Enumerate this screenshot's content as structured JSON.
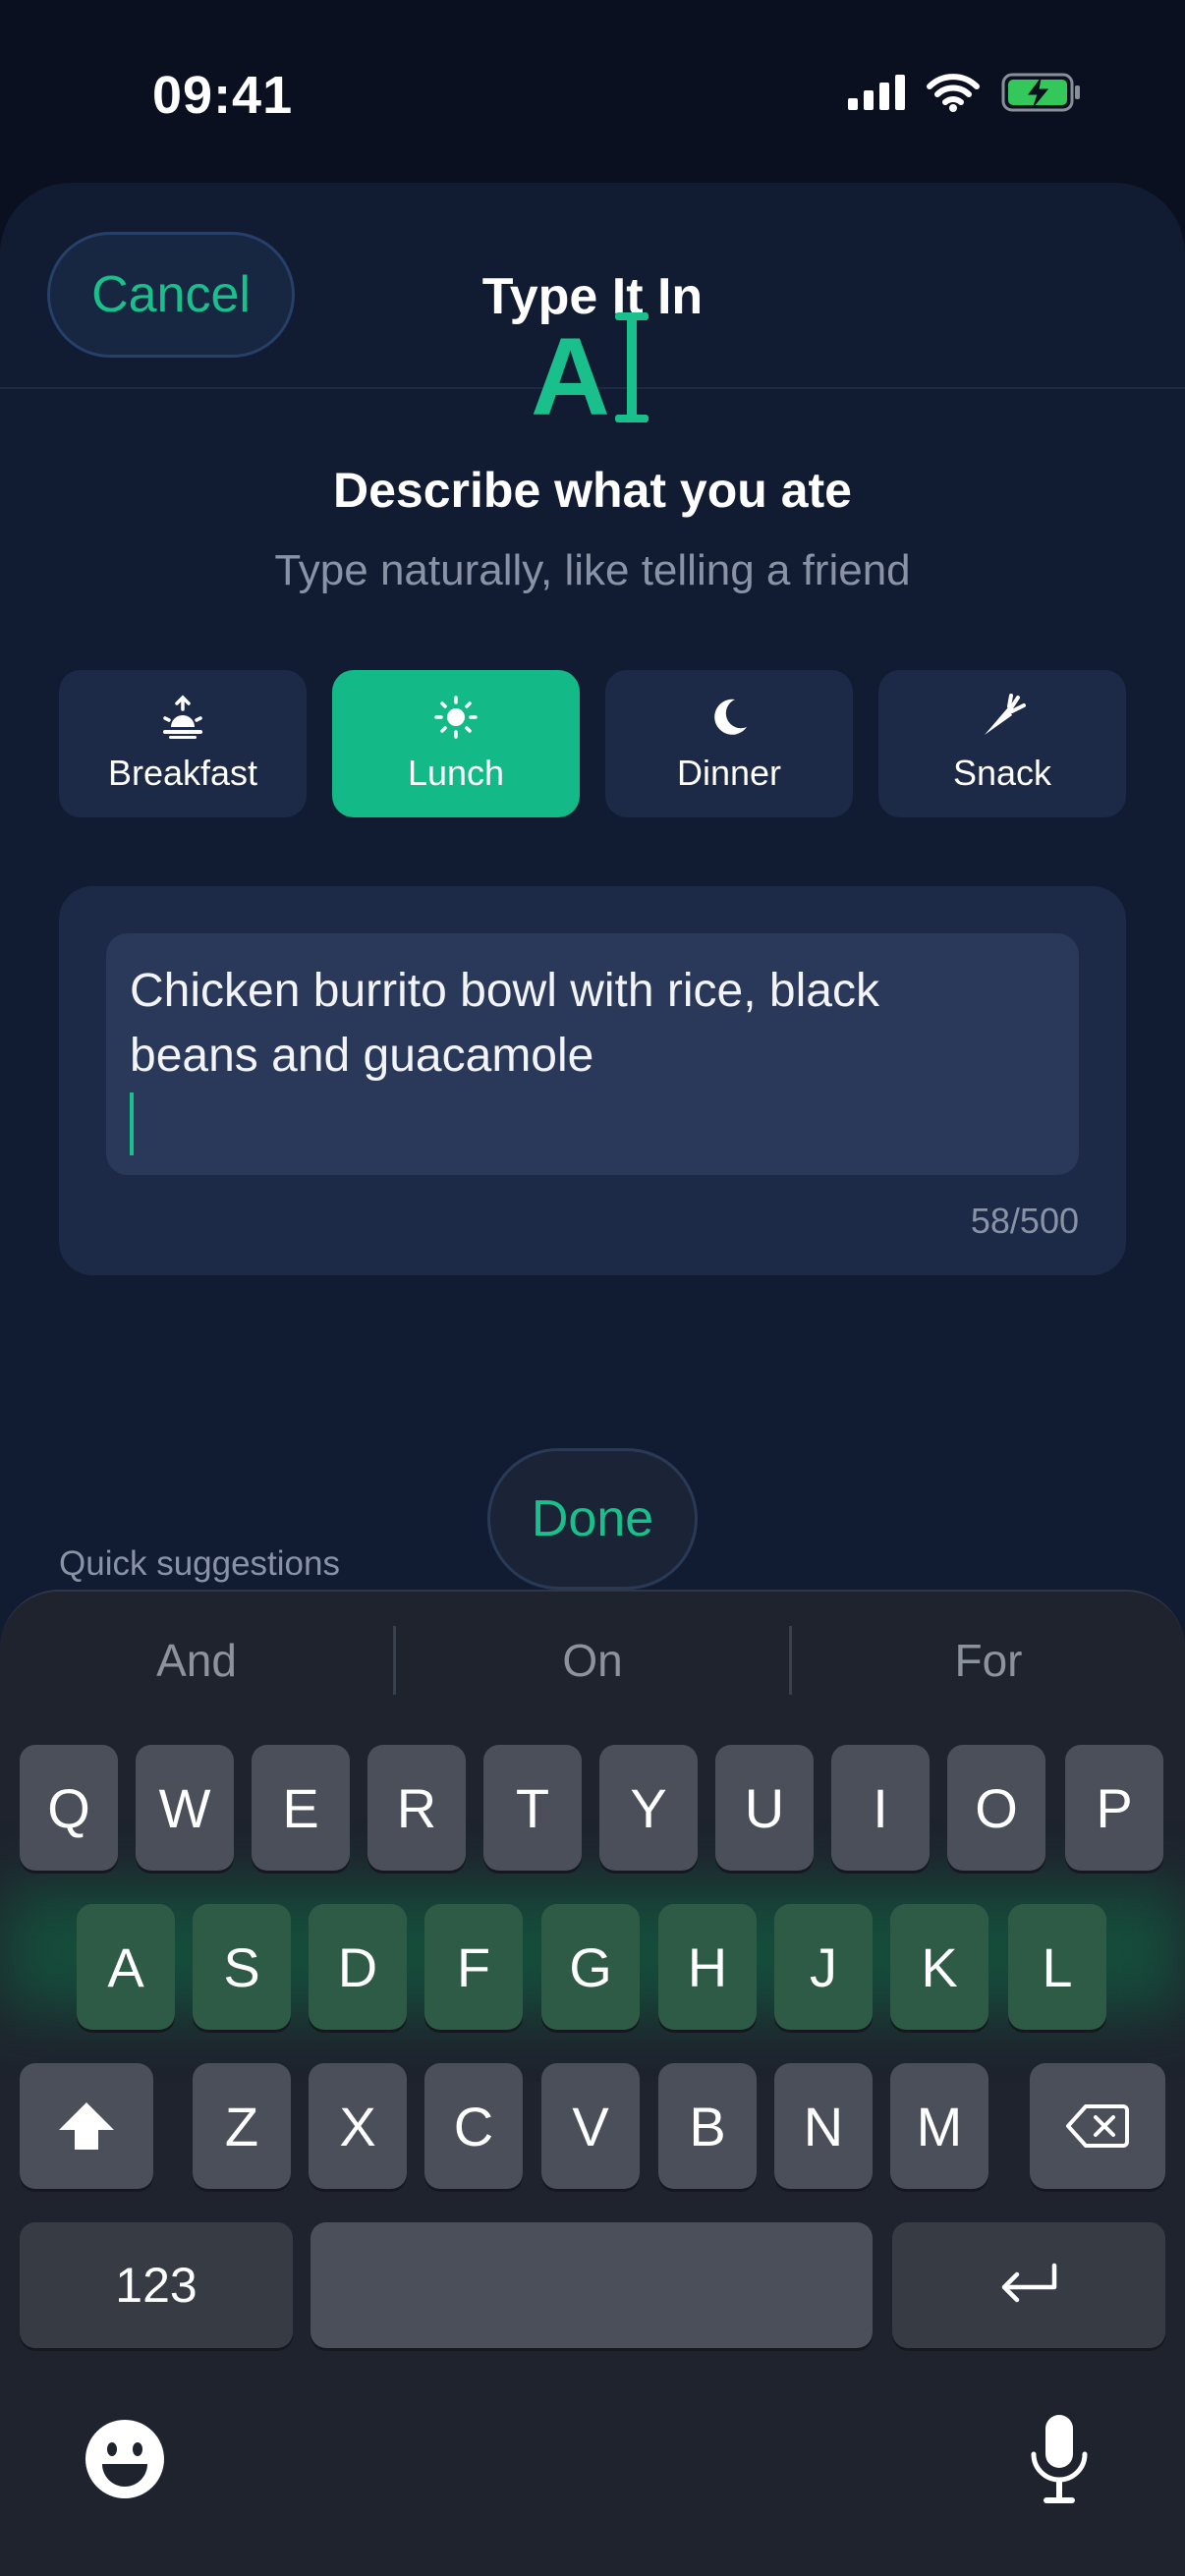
{
  "status": {
    "time": "09:41"
  },
  "nav": {
    "cancel_label": "Cancel",
    "title": "Type It In"
  },
  "hero": {
    "title": "Describe what you ate",
    "subtitle": "Type naturally, like telling a friend"
  },
  "meals": [
    {
      "label": "Breakfast",
      "icon": "sunrise-icon",
      "selected": false
    },
    {
      "label": "Lunch",
      "icon": "sun-icon",
      "selected": true
    },
    {
      "label": "Dinner",
      "icon": "moon-icon",
      "selected": false
    },
    {
      "label": "Snack",
      "icon": "carrot-icon",
      "selected": false
    }
  ],
  "input": {
    "value_line1": "Chicken burrito bowl with rice, black",
    "value_line2": "beans and guacamole",
    "char_count": "58/500"
  },
  "done_label": "Done",
  "quick_suggestions_label": "Quick suggestions",
  "keyboard": {
    "suggestions": [
      "And",
      "On",
      "For"
    ],
    "row1": [
      "Q",
      "W",
      "E",
      "R",
      "T",
      "Y",
      "U",
      "I",
      "O",
      "P"
    ],
    "row2": [
      "A",
      "S",
      "D",
      "F",
      "G",
      "H",
      "J",
      "K",
      "L"
    ],
    "row3": [
      "Z",
      "X",
      "C",
      "V",
      "B",
      "N",
      "M"
    ],
    "numbers_label": "123"
  },
  "colors": {
    "accent": "#19c08b",
    "background": "#0a1020",
    "sheet": "#111b32",
    "card": "#1c2a48"
  }
}
